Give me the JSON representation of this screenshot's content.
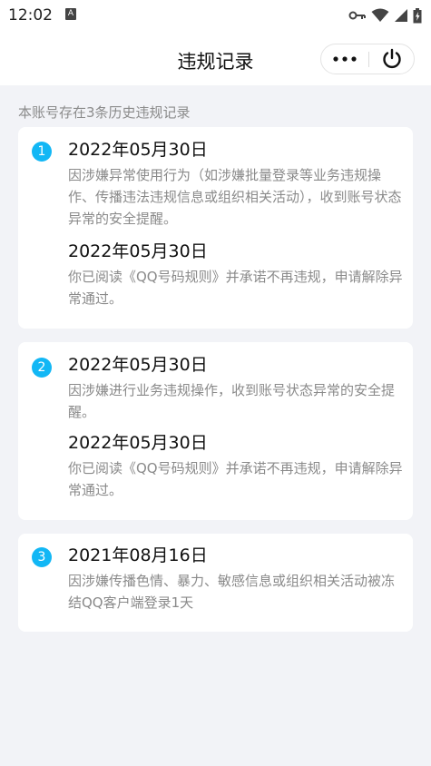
{
  "status": {
    "time": "12:02",
    "notif_letter": "A"
  },
  "header": {
    "title": "违规记录"
  },
  "summary": "本账号存在3条历史违规记录",
  "records": [
    {
      "index": "1",
      "entries": [
        {
          "date": "2022年05月30日",
          "text": "因涉嫌异常使用行为（如涉嫌批量登录等业务违规操作、传播违法违规信息或组织相关活动），收到账号状态异常的安全提醒。"
        },
        {
          "date": "2022年05月30日",
          "text": "你已阅读《QQ号码规则》并承诺不再违规，申请解除异常通过。"
        }
      ]
    },
    {
      "index": "2",
      "entries": [
        {
          "date": "2022年05月30日",
          "text": "因涉嫌进行业务违规操作，收到账号状态异常的安全提醒。"
        },
        {
          "date": "2022年05月30日",
          "text": "你已阅读《QQ号码规则》并承诺不再违规，申请解除异常通过。"
        }
      ]
    },
    {
      "index": "3",
      "entries": [
        {
          "date": "2021年08月16日",
          "text": "因涉嫌传播色情、暴力、敏感信息或组织相关活动被冻结QQ客户端登录1天"
        }
      ]
    }
  ],
  "icons": {
    "status": [
      "key-icon",
      "wifi-icon",
      "signal-icon",
      "battery-icon"
    ],
    "nav": [
      "more-icon",
      "power-icon"
    ]
  },
  "colors": {
    "accent": "#12b7f5",
    "background": "#f2f3f7",
    "card": "#ffffff",
    "secondary_text": "#8a8a8a"
  }
}
